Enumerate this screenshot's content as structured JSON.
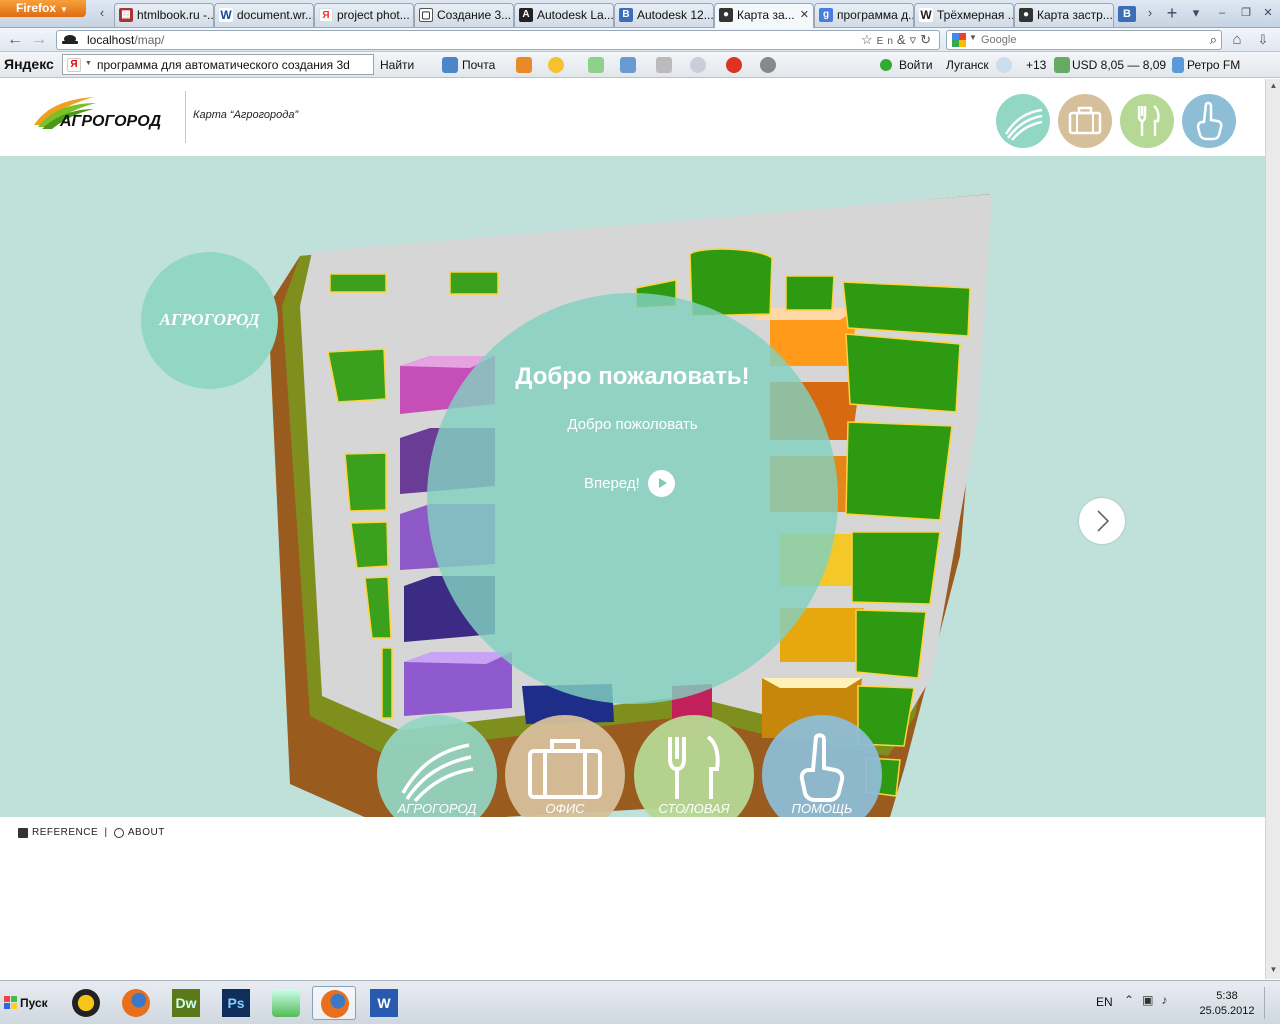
{
  "browser": {
    "menu_button": "Firefox",
    "tabs": [
      {
        "title": "htmlbook.ru -...",
        "icon": "htmlbook-icon",
        "color": "#a33"
      },
      {
        "title": "document.wr...",
        "icon": "w-icon",
        "color": "#124a9a"
      },
      {
        "title": "project phot...",
        "icon": "yandex-icon",
        "color": "#e33"
      },
      {
        "title": "Создание 3...",
        "icon": "page-icon",
        "color": "#555"
      },
      {
        "title": "Autodesk La...",
        "icon": "autodesk-icon",
        "color": "#222"
      },
      {
        "title": "Autodesk 12...",
        "icon": "autodesk-b-icon",
        "color": "#3a6fb5"
      },
      {
        "title": "Карта за...",
        "icon": "spy-icon",
        "color": "#111"
      },
      {
        "title": "программа д...",
        "icon": "google-icon",
        "color": "#4a7de0"
      },
      {
        "title": "Трёхмерная ...",
        "icon": "wikipedia-icon",
        "color": "#666"
      },
      {
        "title": "Карта застр...",
        "icon": "spy-icon",
        "color": "#111"
      }
    ],
    "url_host": "localhost",
    "url_path": "/map/",
    "search_engine": "Google",
    "search_placeholder": "Google"
  },
  "yandex_bar": {
    "logo": "Яндекс",
    "query": "программа для автоматического создания 3d",
    "find": "Найти",
    "mail": "Почта",
    "login": "Войти",
    "city": "Луганск",
    "weather": "+13",
    "currency": "USD 8,05 — 8,09",
    "radio": "Ретро FM"
  },
  "header": {
    "logo_text": "АГРОГОРОД",
    "site_title": "Карта “Агрогорода”"
  },
  "map": {
    "badge": "АГРОГОРОД",
    "welcome_title": "Добро пожаловать!",
    "welcome_subtitle": "Добро пожоловать",
    "forward_label": "Вперед!"
  },
  "menu": [
    {
      "label": "АГРОГОРОД",
      "color": "#92d6c4"
    },
    {
      "label": "ОФИС",
      "color": "#d6bf9b"
    },
    {
      "label": "СТОЛОВАЯ",
      "color": "#b5d894"
    },
    {
      "label": "ПОМОЩЬ",
      "color": "#8ebdd6"
    }
  ],
  "footer": {
    "reference": "REFERENCE",
    "separator": "|",
    "about": "ABOUT"
  },
  "taskbar": {
    "start": "Пуск",
    "language": "EN",
    "time": "5:38",
    "date": "25.05.2012"
  }
}
